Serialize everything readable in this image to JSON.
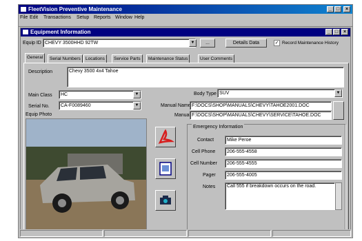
{
  "app": {
    "title": "FleetVision Preventive Maintenance",
    "menu": [
      "File",
      "Edit",
      "Transactions",
      "Setup",
      "Reports",
      "Window",
      "Help"
    ]
  },
  "child": {
    "title": "Equipment Information",
    "equip_id_label": "Equip ID",
    "equip_id_value": "CHEVY 3500HHD 92TW",
    "details_button": "Details Data",
    "record_history_label": "Record Maintenance History",
    "tabs": [
      "General",
      "Serial Numbers",
      "Locations",
      "Service Parts",
      "Maintenance Status",
      "User Comments"
    ],
    "description_label": "Description",
    "description_value": "Chevy 3500 4x4 Tahoe",
    "class_label": "Main Class",
    "class_value": "HC",
    "serial_label": "Serial No.",
    "serial_value": "CA-F0089460",
    "body_type_label": "Body Type",
    "body_type_value": "SUV",
    "manual_name_label": "Manual Name",
    "manual_name_value": "F:\\DOCS\\SHOP\\MANUALS\\CHEVY\\TAHOE2001.DOC",
    "manual_label": "Manual",
    "manual_value": "F:\\DOCS\\SHOP\\MANUALS\\CHEVY\\SERVICE\\TAHOE.DOC",
    "equip_photo_label": "Equip Photo",
    "emergency": {
      "title": "Emergency Information",
      "contact_label": "Contact",
      "contact_value": "Mike Peroe",
      "cell_label": "Cell Phone",
      "cell_value": "206-555-4558",
      "phone_label": "Cell Number",
      "phone_value": "206-555-4555",
      "pager_label": "Pager",
      "pager_value": "206-555-4005",
      "notes_label": "Notes",
      "notes_value": "Call 555 if breakdown occurs on the road."
    }
  },
  "colors": {
    "titlebar": "#000080",
    "face": "#c0c0c0",
    "pdf_red": "#d81e1e"
  }
}
